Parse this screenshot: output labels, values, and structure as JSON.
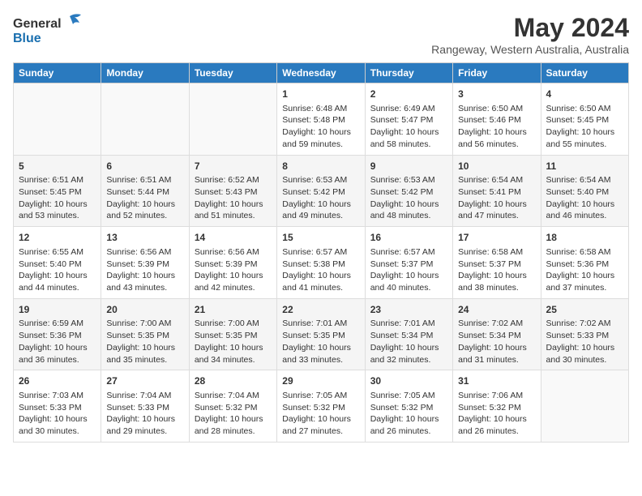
{
  "logo": {
    "general": "General",
    "blue": "Blue"
  },
  "title": "May 2024",
  "subtitle": "Rangeway, Western Australia, Australia",
  "headers": [
    "Sunday",
    "Monday",
    "Tuesday",
    "Wednesday",
    "Thursday",
    "Friday",
    "Saturday"
  ],
  "weeks": [
    [
      {
        "day": "",
        "content": ""
      },
      {
        "day": "",
        "content": ""
      },
      {
        "day": "",
        "content": ""
      },
      {
        "day": "1",
        "content": "Sunrise: 6:48 AM\nSunset: 5:48 PM\nDaylight: 10 hours\nand 59 minutes."
      },
      {
        "day": "2",
        "content": "Sunrise: 6:49 AM\nSunset: 5:47 PM\nDaylight: 10 hours\nand 58 minutes."
      },
      {
        "day": "3",
        "content": "Sunrise: 6:50 AM\nSunset: 5:46 PM\nDaylight: 10 hours\nand 56 minutes."
      },
      {
        "day": "4",
        "content": "Sunrise: 6:50 AM\nSunset: 5:45 PM\nDaylight: 10 hours\nand 55 minutes."
      }
    ],
    [
      {
        "day": "5",
        "content": "Sunrise: 6:51 AM\nSunset: 5:45 PM\nDaylight: 10 hours\nand 53 minutes."
      },
      {
        "day": "6",
        "content": "Sunrise: 6:51 AM\nSunset: 5:44 PM\nDaylight: 10 hours\nand 52 minutes."
      },
      {
        "day": "7",
        "content": "Sunrise: 6:52 AM\nSunset: 5:43 PM\nDaylight: 10 hours\nand 51 minutes."
      },
      {
        "day": "8",
        "content": "Sunrise: 6:53 AM\nSunset: 5:42 PM\nDaylight: 10 hours\nand 49 minutes."
      },
      {
        "day": "9",
        "content": "Sunrise: 6:53 AM\nSunset: 5:42 PM\nDaylight: 10 hours\nand 48 minutes."
      },
      {
        "day": "10",
        "content": "Sunrise: 6:54 AM\nSunset: 5:41 PM\nDaylight: 10 hours\nand 47 minutes."
      },
      {
        "day": "11",
        "content": "Sunrise: 6:54 AM\nSunset: 5:40 PM\nDaylight: 10 hours\nand 46 minutes."
      }
    ],
    [
      {
        "day": "12",
        "content": "Sunrise: 6:55 AM\nSunset: 5:40 PM\nDaylight: 10 hours\nand 44 minutes."
      },
      {
        "day": "13",
        "content": "Sunrise: 6:56 AM\nSunset: 5:39 PM\nDaylight: 10 hours\nand 43 minutes."
      },
      {
        "day": "14",
        "content": "Sunrise: 6:56 AM\nSunset: 5:39 PM\nDaylight: 10 hours\nand 42 minutes."
      },
      {
        "day": "15",
        "content": "Sunrise: 6:57 AM\nSunset: 5:38 PM\nDaylight: 10 hours\nand 41 minutes."
      },
      {
        "day": "16",
        "content": "Sunrise: 6:57 AM\nSunset: 5:37 PM\nDaylight: 10 hours\nand 40 minutes."
      },
      {
        "day": "17",
        "content": "Sunrise: 6:58 AM\nSunset: 5:37 PM\nDaylight: 10 hours\nand 38 minutes."
      },
      {
        "day": "18",
        "content": "Sunrise: 6:58 AM\nSunset: 5:36 PM\nDaylight: 10 hours\nand 37 minutes."
      }
    ],
    [
      {
        "day": "19",
        "content": "Sunrise: 6:59 AM\nSunset: 5:36 PM\nDaylight: 10 hours\nand 36 minutes."
      },
      {
        "day": "20",
        "content": "Sunrise: 7:00 AM\nSunset: 5:35 PM\nDaylight: 10 hours\nand 35 minutes."
      },
      {
        "day": "21",
        "content": "Sunrise: 7:00 AM\nSunset: 5:35 PM\nDaylight: 10 hours\nand 34 minutes."
      },
      {
        "day": "22",
        "content": "Sunrise: 7:01 AM\nSunset: 5:35 PM\nDaylight: 10 hours\nand 33 minutes."
      },
      {
        "day": "23",
        "content": "Sunrise: 7:01 AM\nSunset: 5:34 PM\nDaylight: 10 hours\nand 32 minutes."
      },
      {
        "day": "24",
        "content": "Sunrise: 7:02 AM\nSunset: 5:34 PM\nDaylight: 10 hours\nand 31 minutes."
      },
      {
        "day": "25",
        "content": "Sunrise: 7:02 AM\nSunset: 5:33 PM\nDaylight: 10 hours\nand 30 minutes."
      }
    ],
    [
      {
        "day": "26",
        "content": "Sunrise: 7:03 AM\nSunset: 5:33 PM\nDaylight: 10 hours\nand 30 minutes."
      },
      {
        "day": "27",
        "content": "Sunrise: 7:04 AM\nSunset: 5:33 PM\nDaylight: 10 hours\nand 29 minutes."
      },
      {
        "day": "28",
        "content": "Sunrise: 7:04 AM\nSunset: 5:32 PM\nDaylight: 10 hours\nand 28 minutes."
      },
      {
        "day": "29",
        "content": "Sunrise: 7:05 AM\nSunset: 5:32 PM\nDaylight: 10 hours\nand 27 minutes."
      },
      {
        "day": "30",
        "content": "Sunrise: 7:05 AM\nSunset: 5:32 PM\nDaylight: 10 hours\nand 26 minutes."
      },
      {
        "day": "31",
        "content": "Sunrise: 7:06 AM\nSunset: 5:32 PM\nDaylight: 10 hours\nand 26 minutes."
      },
      {
        "day": "",
        "content": ""
      }
    ]
  ]
}
